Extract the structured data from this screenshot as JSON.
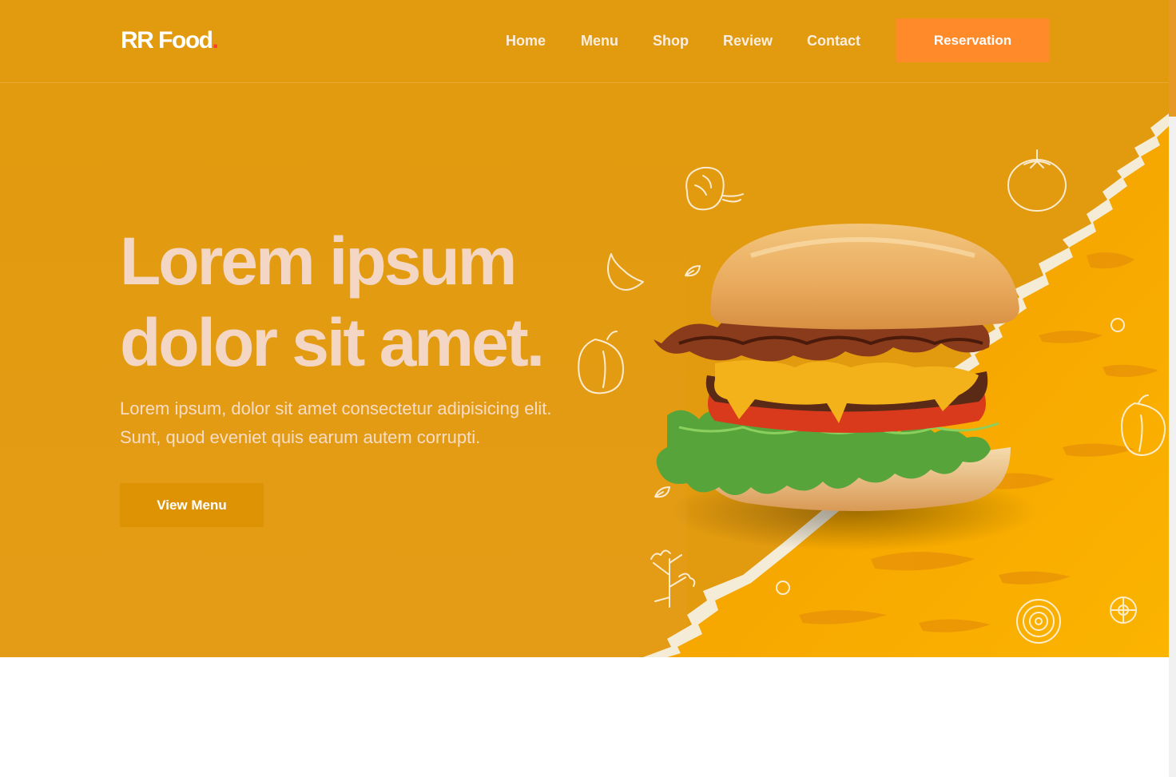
{
  "brand": {
    "name": "RR Food",
    "dot": "."
  },
  "nav": {
    "items": [
      {
        "label": "Home"
      },
      {
        "label": "Menu"
      },
      {
        "label": "Shop"
      },
      {
        "label": "Review"
      },
      {
        "label": "Contact"
      }
    ],
    "cta_label": "Reservation"
  },
  "hero": {
    "title_line1": "Lorem ipsum",
    "title_line2": "dolor sit amet.",
    "subtitle": "Lorem ipsum, dolor sit amet consectetur adipisicing elit. Sunt, quod eveniet quis earum autem corrupti.",
    "button_label": "View Menu",
    "image_subject": "burger-image"
  },
  "colors": {
    "hero_background": "#e29a0e",
    "accent_panel": "#f7a000",
    "reservation_button": "#ff8a2a",
    "view_menu_button": "#de9305",
    "brand_dot": "#ff3b30",
    "headline": "#f3d6c4"
  },
  "icons": [
    "shrimp-icon",
    "tomato-icon",
    "garlic-icon",
    "leaf-icon",
    "pepper-icon",
    "ring-icon",
    "parsley-icon",
    "onion-icon",
    "lemon-slice-icon",
    "bell-pepper-icon"
  ]
}
